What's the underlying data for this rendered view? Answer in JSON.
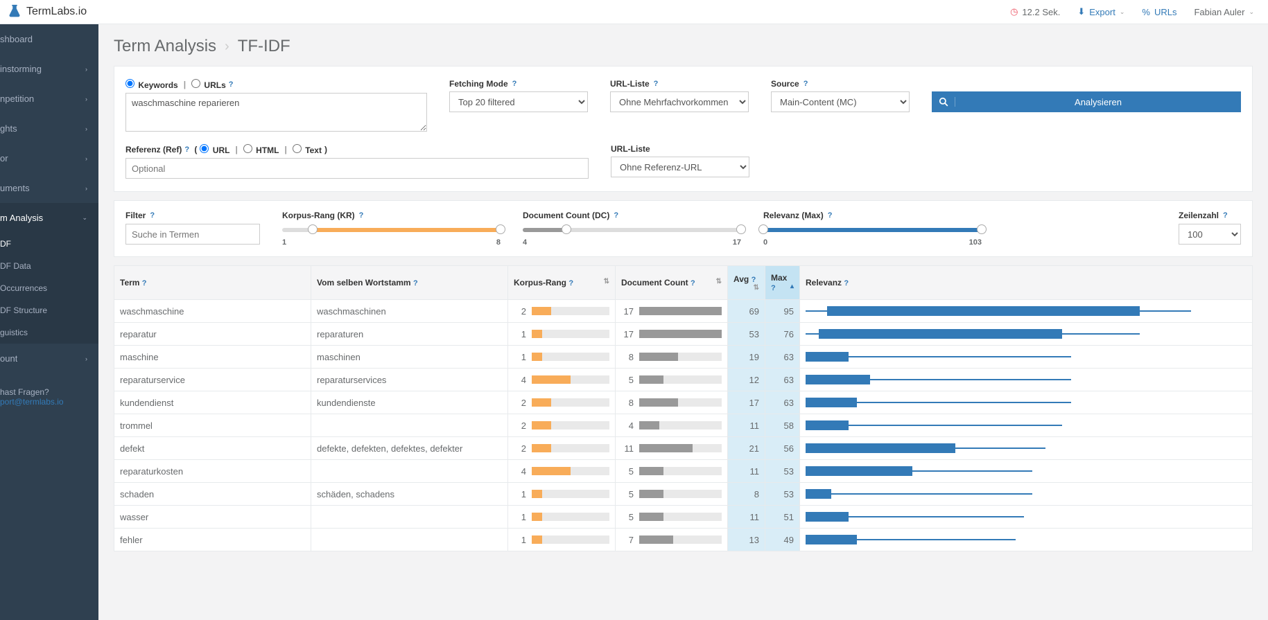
{
  "topbar": {
    "logo_text": "TermLabs.io",
    "timer": "12.2 Sek.",
    "export": "Export",
    "urls": "URLs",
    "user": "Fabian Auler"
  },
  "sidebar": {
    "items": [
      {
        "label": "shboard",
        "arrow": false
      },
      {
        "label": "instorming",
        "arrow": true
      },
      {
        "label": "npetition",
        "arrow": true
      },
      {
        "label": "ghts",
        "arrow": true
      },
      {
        "label": "or",
        "arrow": true
      },
      {
        "label": "uments",
        "arrow": true
      },
      {
        "label": "m Analysis",
        "arrow": true,
        "active": true,
        "sub": [
          {
            "label": "DF",
            "active": true
          },
          {
            "label": "DF Data"
          },
          {
            "label": "Occurrences"
          },
          {
            "label": "DF Structure"
          },
          {
            "label": "guistics"
          }
        ]
      },
      {
        "label": "ount",
        "arrow": true
      }
    ],
    "footer_q": "hast Fragen?",
    "footer_mail": "port@termlabs.io"
  },
  "breadcrumb": {
    "main": "Term Analysis",
    "sub": "TF-IDF"
  },
  "form": {
    "keywords_radio": {
      "keywords": "Keywords",
      "urls": "URLs"
    },
    "keywords_value": "waschmaschine reparieren",
    "fetching_label": "Fetching Mode",
    "fetching_value": "Top 20 filtered",
    "urlliste_label": "URL-Liste",
    "urlliste_value": "Ohne Mehrfachvorkommen",
    "source_label": "Source",
    "source_value": "Main-Content (MC)",
    "analyze": "Analysieren",
    "ref_label": "Referenz (Ref)",
    "ref_radios": {
      "url": "URL",
      "html": "HTML",
      "text": "Text"
    },
    "ref_placeholder": "Optional",
    "urlliste2_label": "URL-Liste",
    "urlliste2_value": "Ohne Referenz-URL"
  },
  "filter": {
    "filter_label": "Filter",
    "filter_placeholder": "Suche in Termen",
    "kr": {
      "label": "Korpus-Rang (KR)",
      "min": "1",
      "max": "8"
    },
    "dc": {
      "label": "Document Count (DC)",
      "min": "4",
      "max": "17"
    },
    "rel": {
      "label": "Relevanz (Max)",
      "min": "0",
      "max": "103"
    },
    "zeilen_label": "Zeilenzahl",
    "zeilen_value": "100"
  },
  "table": {
    "headers": {
      "term": "Term",
      "stem": "Vom selben Wortstamm",
      "kr": "Korpus-Rang",
      "dc": "Document Count",
      "avg": "Avg",
      "max": "Max",
      "rel": "Relevanz"
    },
    "kr_max": 8,
    "dc_max": 17,
    "rel_max": 103,
    "rows": [
      {
        "term": "waschmaschine",
        "stem": "waschmaschinen",
        "kr": 2,
        "dc": 17,
        "avg": 69,
        "max": 95,
        "rel_box": [
          5,
          78
        ],
        "rel_line": [
          0,
          90
        ]
      },
      {
        "term": "reparatur",
        "stem": "reparaturen",
        "kr": 1,
        "dc": 17,
        "avg": 53,
        "max": 76,
        "rel_box": [
          3,
          60
        ],
        "rel_line": [
          0,
          78
        ]
      },
      {
        "term": "maschine",
        "stem": "maschinen",
        "kr": 1,
        "dc": 8,
        "avg": 19,
        "max": 63,
        "rel_box": [
          0,
          10
        ],
        "rel_line": [
          0,
          62
        ]
      },
      {
        "term": "reparaturservice",
        "stem": "reparaturservices",
        "kr": 4,
        "dc": 5,
        "avg": 12,
        "max": 63,
        "rel_box": [
          0,
          15
        ],
        "rel_line": [
          0,
          62
        ]
      },
      {
        "term": "kundendienst",
        "stem": "kundendienste",
        "kr": 2,
        "dc": 8,
        "avg": 17,
        "max": 63,
        "rel_box": [
          0,
          12
        ],
        "rel_line": [
          0,
          62
        ]
      },
      {
        "term": "trommel",
        "stem": "",
        "kr": 2,
        "dc": 4,
        "avg": 11,
        "max": 58,
        "rel_box": [
          0,
          10
        ],
        "rel_line": [
          0,
          60
        ]
      },
      {
        "term": "defekt",
        "stem": "defekte, defekten, defektes, defekter",
        "kr": 2,
        "dc": 11,
        "avg": 21,
        "max": 56,
        "rel_box": [
          0,
          35
        ],
        "rel_line": [
          0,
          56
        ]
      },
      {
        "term": "reparaturkosten",
        "stem": "",
        "kr": 4,
        "dc": 5,
        "avg": 11,
        "max": 53,
        "rel_box": [
          0,
          25
        ],
        "rel_line": [
          0,
          53
        ]
      },
      {
        "term": "schaden",
        "stem": "schäden, schadens",
        "kr": 1,
        "dc": 5,
        "avg": 8,
        "max": 53,
        "rel_box": [
          0,
          6
        ],
        "rel_line": [
          0,
          53
        ]
      },
      {
        "term": "wasser",
        "stem": "",
        "kr": 1,
        "dc": 5,
        "avg": 11,
        "max": 51,
        "rel_box": [
          0,
          10
        ],
        "rel_line": [
          0,
          51
        ]
      },
      {
        "term": "fehler",
        "stem": "",
        "kr": 1,
        "dc": 7,
        "avg": 13,
        "max": 49,
        "rel_box": [
          0,
          12
        ],
        "rel_line": [
          0,
          49
        ]
      }
    ]
  }
}
